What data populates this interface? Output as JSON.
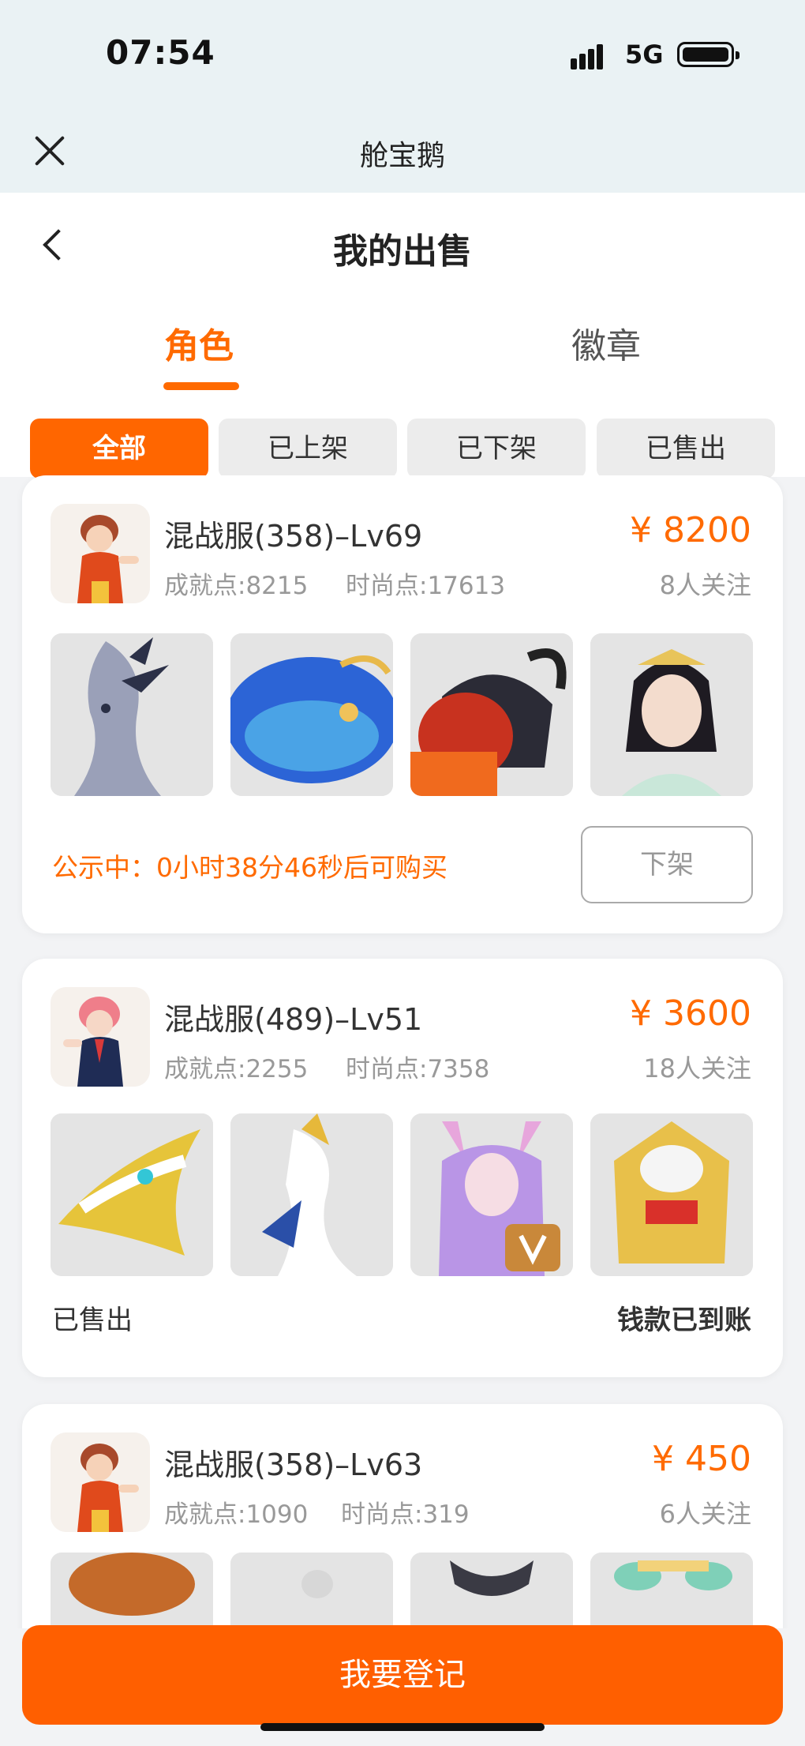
{
  "status_bar": {
    "time": "07:54",
    "network": "5G"
  },
  "app_bar": {
    "title": "舱宝鹅"
  },
  "header": {
    "title": "我的出售"
  },
  "tabs": [
    {
      "label": "角色",
      "active": true
    },
    {
      "label": "徽章",
      "active": false
    }
  ],
  "filters": [
    {
      "label": "全部",
      "active": true
    },
    {
      "label": "已上架",
      "active": false
    },
    {
      "label": "已下架",
      "active": false
    },
    {
      "label": "已售出",
      "active": false
    }
  ],
  "listings": [
    {
      "server": "混战服(358)–Lv69",
      "achievement": "成就点:8215",
      "fashion": "时尚点:17613",
      "price": "¥ 8200",
      "followers": "8人关注",
      "thumbs": [
        "silver-dragon-mount",
        "blue-whale-mount",
        "black-ram-mount",
        "female-avatar"
      ],
      "notice": "公示中：0小时38分46秒后可购买",
      "action_label": "下架"
    },
    {
      "server": "混战服(489)–Lv51",
      "achievement": "成就点:2255",
      "fashion": "时尚点:7358",
      "price": "¥ 3600",
      "followers": "18人关注",
      "thumbs": [
        "gold-dragon-mount",
        "white-swan-mount",
        "fox-girl-avatar",
        "gold-armor-mount"
      ],
      "status": "已售出",
      "payout": "钱款已到账"
    },
    {
      "server": "混战服(358)–Lv63",
      "achievement": "成就点:1090",
      "fashion": "时尚点:319",
      "price": "¥ 450",
      "followers": "6人关注",
      "thumbs": [
        "fire-beast-mount",
        "owl-mount",
        "horned-mount",
        "jade-mount"
      ]
    }
  ],
  "bottom_button": {
    "label": "我要登记"
  },
  "colors": {
    "accent": "#ff6600",
    "price": "#ff6a00"
  }
}
